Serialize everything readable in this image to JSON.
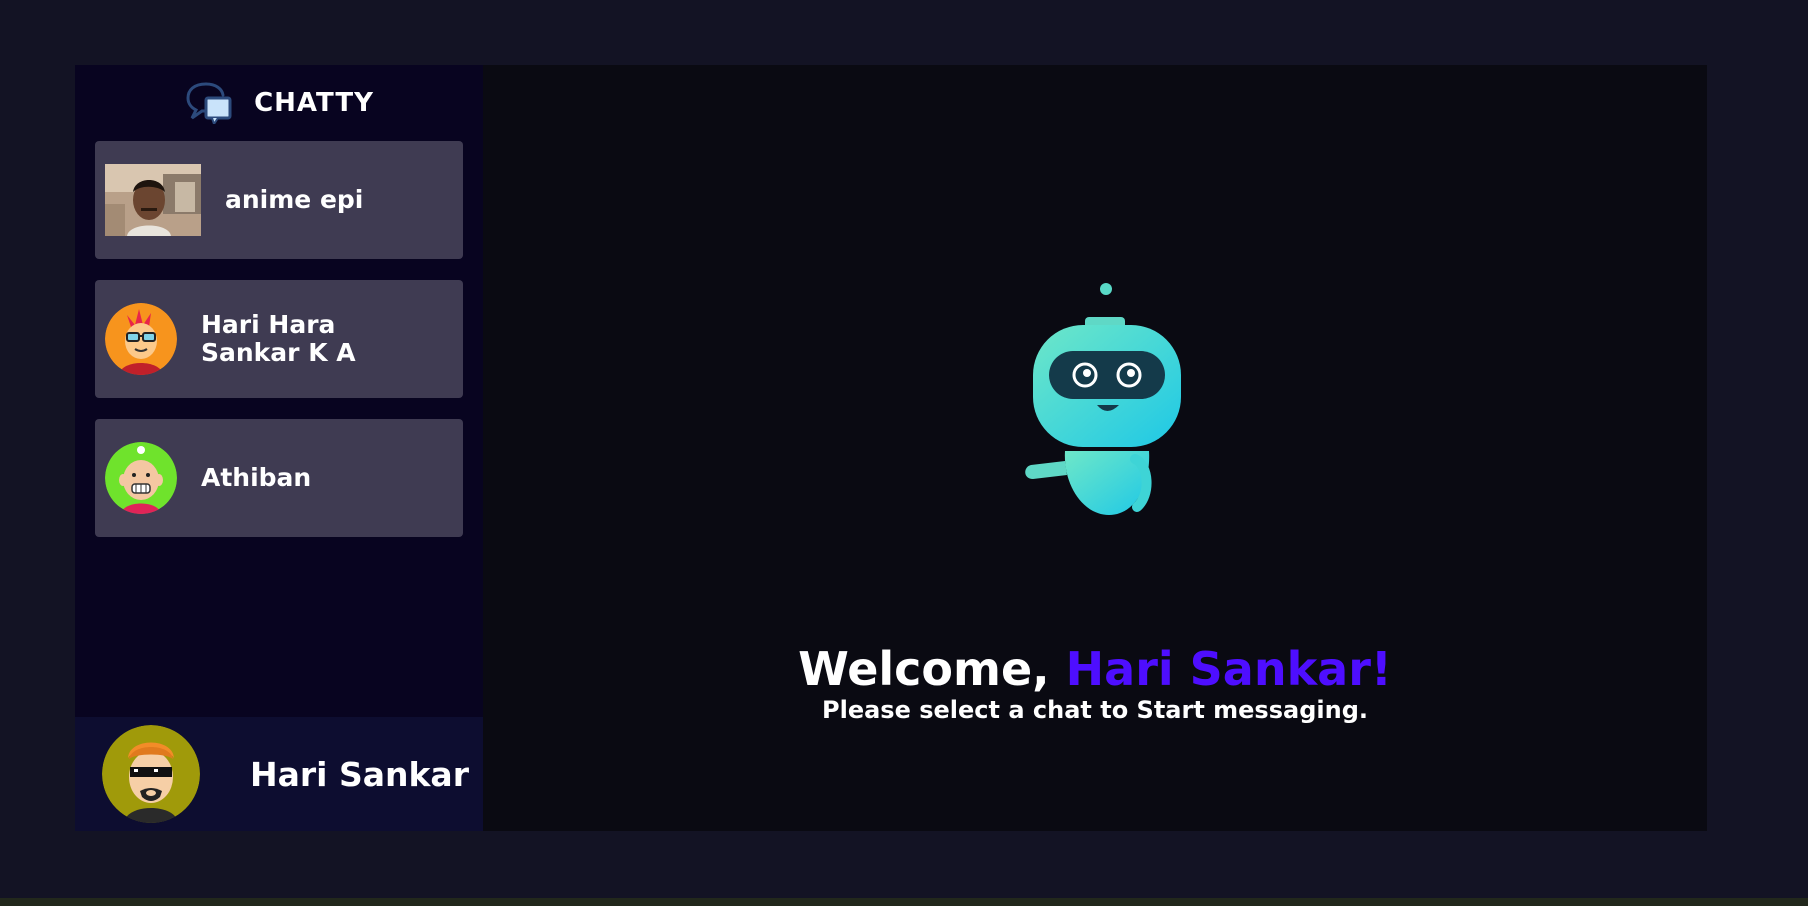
{
  "brand": {
    "title": "CHATTY",
    "icon": "chat-bubbles-icon"
  },
  "contacts": [
    {
      "name": "anime epi",
      "avatar": "photo-avatar"
    },
    {
      "name": "Hari Hara Sankar K A",
      "avatar": "cartoon-glasses-avatar"
    },
    {
      "name": "Athiban",
      "avatar": "cartoon-bald-avatar"
    }
  ],
  "current_user": {
    "name": "Hari Sankar",
    "avatar": "cartoon-sunglasses-avatar"
  },
  "welcome": {
    "greeting": "Welcome,",
    "username": "Hari Sankar!",
    "subtitle": "Please select a chat to Start messaging."
  },
  "colors": {
    "accent": "#4e0eff",
    "sidebar_bg": "#080420",
    "contact_bg": "#3f3b52",
    "page_bg": "#131324"
  }
}
